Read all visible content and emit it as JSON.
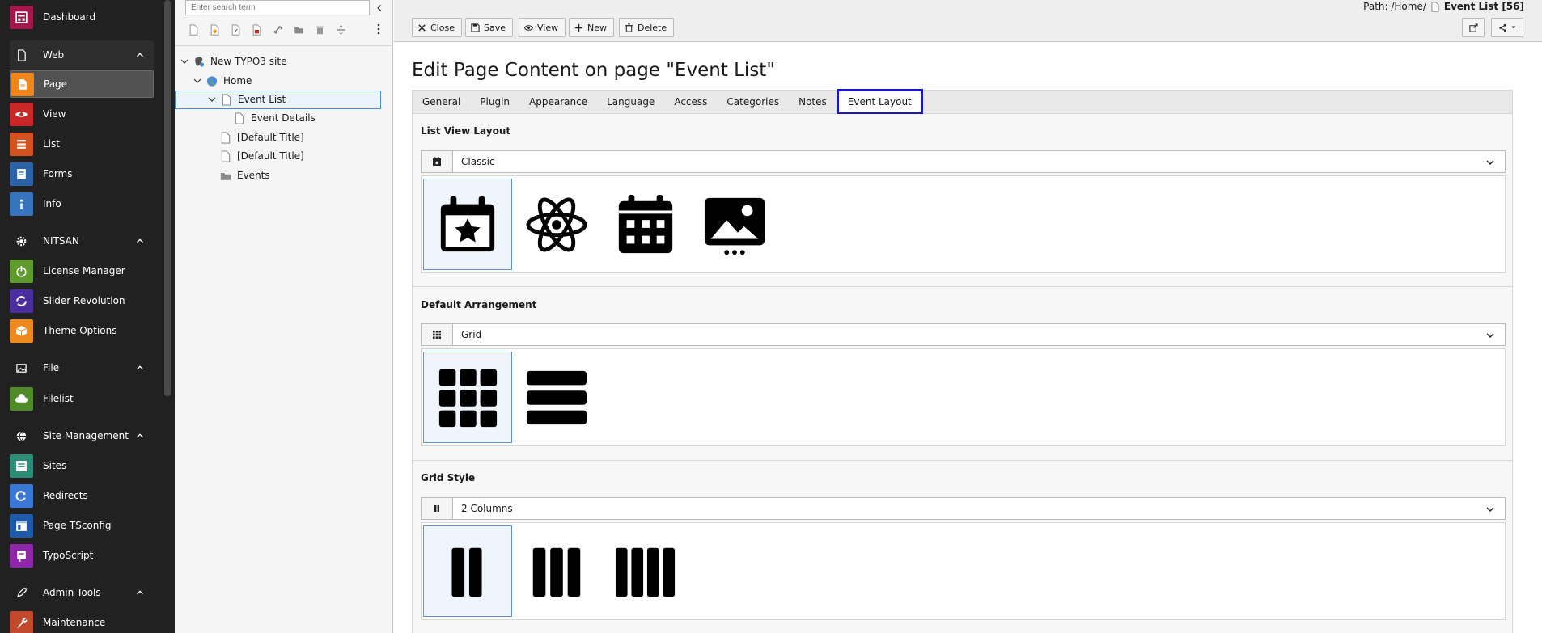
{
  "modules": {
    "items": [
      {
        "key": "dashboard",
        "label": "Dashboard",
        "color": "#a2184d",
        "icon": "dashboard-icon"
      },
      {
        "key": "page",
        "label": "Page",
        "color": "#f18519",
        "icon": "page-icon"
      },
      {
        "key": "view",
        "label": "View",
        "color": "#c82828",
        "icon": "eye-icon"
      },
      {
        "key": "list",
        "label": "List",
        "color": "#d2531f",
        "icon": "list-icon"
      },
      {
        "key": "forms",
        "label": "Forms",
        "color": "#2e62a6",
        "icon": "forms-icon"
      },
      {
        "key": "info",
        "label": "Info",
        "color": "#3774bd",
        "icon": "info-icon"
      },
      {
        "key": "license",
        "label": "License Manager",
        "color": "#5f9a2e",
        "icon": "power-icon"
      },
      {
        "key": "slider",
        "label": "Slider Revolution",
        "color": "#4a2e9e",
        "icon": "slider-icon"
      },
      {
        "key": "theme",
        "label": "Theme Options",
        "color": "#ee8a1d",
        "icon": "box-icon"
      },
      {
        "key": "filelist",
        "label": "Filelist",
        "color": "#4f8b2a",
        "icon": "cloud-icon"
      },
      {
        "key": "sites",
        "label": "Sites",
        "color": "#2c8c76",
        "icon": "sites-icon"
      },
      {
        "key": "redirects",
        "label": "Redirects",
        "color": "#3a78d6",
        "icon": "redirect-icon"
      },
      {
        "key": "tsconfig",
        "label": "Page TSconfig",
        "color": "#1e5aa8",
        "icon": "tsconfig-icon"
      },
      {
        "key": "typoscript",
        "label": "TypoScript",
        "color": "#8e26a8",
        "icon": "typoscript-icon"
      },
      {
        "key": "maintenance",
        "label": "Maintenance",
        "color": "#c3492d",
        "icon": "wrench-icon"
      }
    ],
    "groups": {
      "web": "Web",
      "nitsan": "NITSAN",
      "file": "File",
      "site": "Site Management",
      "admin": "Admin Tools"
    }
  },
  "tree": {
    "search_placeholder": "Enter search term",
    "nodes": {
      "root": "New TYPO3 site",
      "home": "Home",
      "event_list": "Event List",
      "event_details": "Event Details",
      "default1": "[Default Title]",
      "default2": "[Default Title]",
      "events": "Events"
    }
  },
  "toolbar": {
    "close": "Close",
    "save": "Save",
    "view": "View",
    "new": "New",
    "delete": "Delete"
  },
  "path": {
    "prefix": "Path: /Home/",
    "current": "Event List [56]"
  },
  "page_title": "Edit Page Content on page \"Event List\"",
  "tabs": [
    "General",
    "Plugin",
    "Appearance",
    "Language",
    "Access",
    "Categories",
    "Notes",
    "Event Layout"
  ],
  "active_tab": "Event Layout",
  "sections": {
    "list_view": {
      "title": "List View Layout",
      "value": "Classic"
    },
    "arrangement": {
      "title": "Default Arrangement",
      "value": "Grid"
    },
    "grid_style": {
      "title": "Grid Style",
      "value": "2 Columns"
    }
  },
  "colors": {
    "active_tab_border": "#1b16cc",
    "selection_border": "#4c8dd6"
  }
}
